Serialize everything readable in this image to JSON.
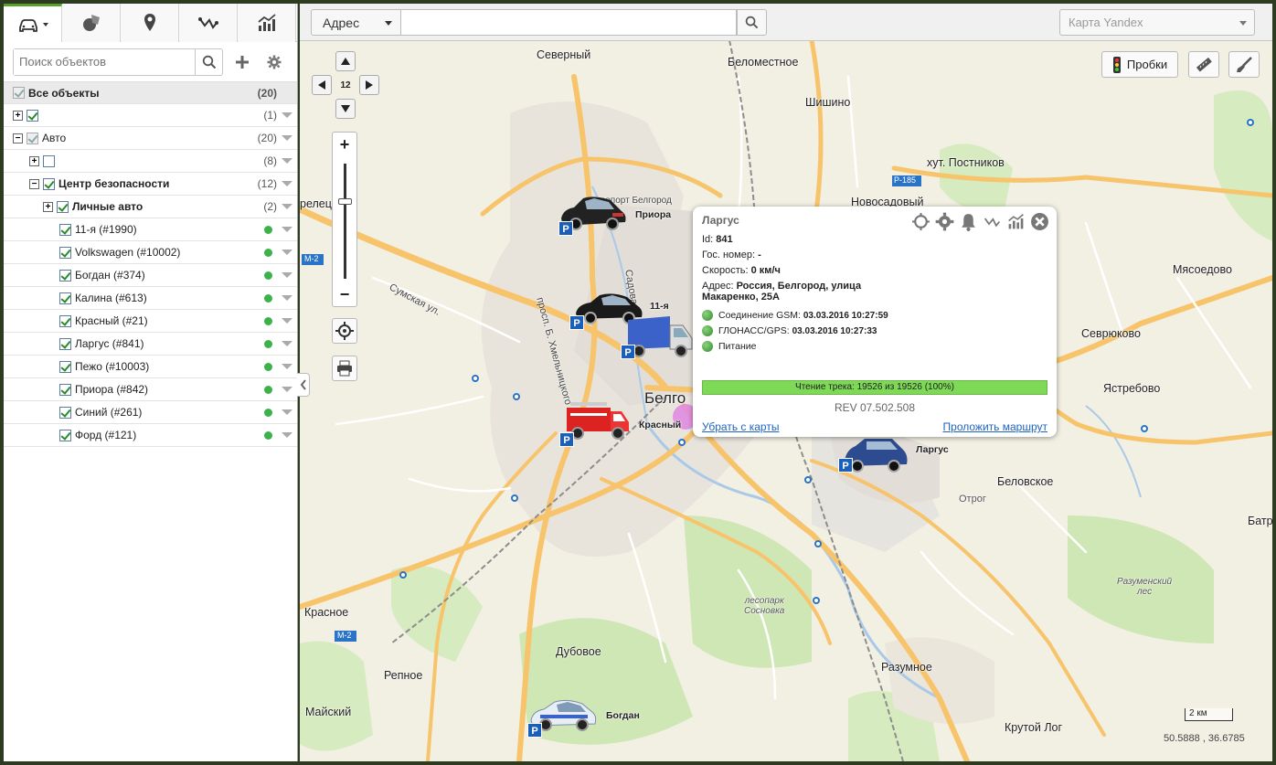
{
  "left": {
    "search_placeholder": "Поиск объектов",
    "tree": [
      {
        "label": "Все объекты",
        "count": "(20)"
      },
      {
        "label": "",
        "count": "(1)"
      },
      {
        "label": "Авто",
        "count": "(20)"
      },
      {
        "label": "",
        "count": "(8)"
      },
      {
        "label": "Центр безопасности",
        "count": "(12)"
      },
      {
        "label": "Личные авто",
        "count": "(2)"
      },
      {
        "label": "11-я (#1990)"
      },
      {
        "label": "Volkswagen (#10002)"
      },
      {
        "label": "Богдан (#374)"
      },
      {
        "label": "Калина (#613)"
      },
      {
        "label": "Красный (#21)"
      },
      {
        "label": "Ларгус (#841)"
      },
      {
        "label": "Пежо (#10003)"
      },
      {
        "label": "Приора (#842)"
      },
      {
        "label": "Синий (#261)"
      },
      {
        "label": "Форд (#121)"
      }
    ]
  },
  "toolbar": {
    "address_select": "Адрес",
    "map_type": "Карта Yandex",
    "traffic_label": "Пробки",
    "zoom_level": "12"
  },
  "places": {
    "severny": "Северный",
    "belomestnoe": "Беломестное",
    "shishino": "Шишино",
    "postnikov": "хут. Постников",
    "novosadovy": "Новосадовый",
    "myasoedovo": "Мясоедово",
    "sevryukovo": "Севрюково",
    "yastrebovo": "Ястребово",
    "belovskoe": "Беловское",
    "otrog": "Отрог",
    "batrat": "Батра",
    "razumensky_les": "Разуменский\nлес",
    "razumnoe": "Разумное",
    "krutoy_log": "Крутой Лог",
    "lesopark": "лесопарк\nСосновка",
    "dubovoe": "Дубовое",
    "repnoe": "Репное",
    "maysky": "Майский",
    "krasnoe": "Красное",
    "belgorod": "Белго",
    "airport": "аэропорт Белгород",
    "sumskaya": "Сумская ул.",
    "khmelnitsky": "просп. Б. Хмельницкого",
    "sadovaya": "Садовая",
    "oreletc": "релец",
    "r185": "Р-185",
    "m2a": "М-2",
    "m2b": "М-2"
  },
  "vehicles": {
    "priora": "Приора",
    "eleven": "11-я",
    "krasny": "Красный",
    "largus": "Ларгус",
    "bogdan": "Богдан"
  },
  "popup": {
    "title": "Ларгус",
    "id_label": "Id:",
    "id_value": "841",
    "plate_label": "Гос. номер:",
    "plate_value": "-",
    "speed_label": "Скорость:",
    "speed_value": "0 км/ч",
    "addr_label": "Адрес:",
    "addr_value1": "Россия, Белгород, улица",
    "addr_value2": "Макаренко, 25А",
    "gsm_label": "Соединение GSM:",
    "gsm_value": "03.03.2016 10:27:59",
    "gps_label": "ГЛОНАСС/GPS:",
    "gps_value": "03.03.2016 10:27:33",
    "power_label": "Питание",
    "progress_text": "Чтение трека: 19526 из 19526 (100%)",
    "progress_percent": 100,
    "rev": "REV 07.502.508",
    "remove_link": "Убрать с карты",
    "route_link": "Проложить маршрут"
  },
  "map_footer": {
    "scale": "2 км",
    "coords": "50.5888 , 36.6785"
  },
  "colors": {
    "accent": "#5aa02c",
    "status_ok": "#3bb34a",
    "link": "#1d63c2",
    "progress": "#7ed957"
  }
}
